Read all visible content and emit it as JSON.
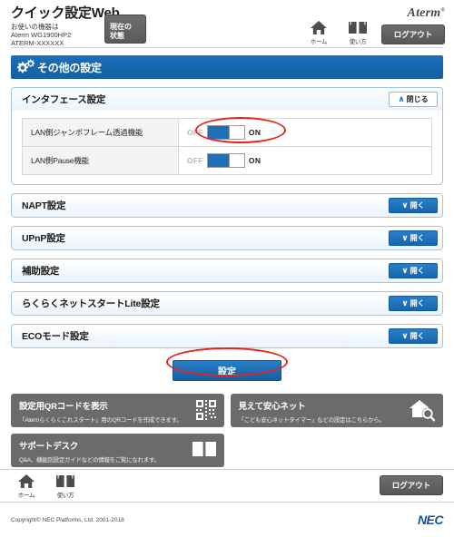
{
  "header": {
    "brand_title": "クイック設定Web",
    "device_lines": [
      "お使いの機器は",
      "Aterm WG1900HP2",
      "ATERM-XXXXXX"
    ],
    "status_button_label": "現在の\n状態",
    "status_button_line1": "現在の",
    "status_button_line2": "状態",
    "aterm_logo": "Aterm",
    "nav": [
      {
        "icon": "home-icon",
        "label": "ホーム"
      },
      {
        "icon": "book-icon",
        "label": "使い方"
      }
    ],
    "logout_label": "ログアウト"
  },
  "section": {
    "icon": "gears-icon",
    "title": "その他の設定"
  },
  "interface_panel": {
    "title": "インタフェース設定",
    "toggle_label": "閉じる",
    "toggle_chevron": "∧",
    "rows": [
      {
        "label": "LAN側ジャンボフレーム透過機能",
        "off_label": "OFF",
        "on_label": "ON",
        "state": "ON"
      },
      {
        "label": "LAN側Pause機能",
        "off_label": "OFF",
        "on_label": "ON",
        "state": "ON"
      }
    ]
  },
  "collapsed_panels": [
    {
      "title": "NAPT設定",
      "toggle_label": "開く",
      "toggle_chevron": "∨"
    },
    {
      "title": "UPnP設定",
      "toggle_label": "開く",
      "toggle_chevron": "∨"
    },
    {
      "title": "補助設定",
      "toggle_label": "開く",
      "toggle_chevron": "∨"
    },
    {
      "title": "らくらくネットスタートLite設定",
      "toggle_label": "開く",
      "toggle_chevron": "∨"
    },
    {
      "title": "ECOモード設定",
      "toggle_label": "開く",
      "toggle_chevron": "∨"
    }
  ],
  "submit": {
    "label": "設定"
  },
  "tiles": [
    {
      "title": "設定用QRコードを表示",
      "subtitle": "「Atermらくらくこれスタート」用のQRコードを作成できます。",
      "icon": "qr-code-icon"
    },
    {
      "title": "サポートデスク",
      "subtitle": "Q&A、機能別設定ガイドなどの情報をご覧になれます。",
      "icon": "book-icon"
    },
    {
      "title": "見えて安心ネット",
      "subtitle": "「こども安心ネットタイマー」などの設定はこちらから。",
      "icon": "house-search-icon"
    }
  ],
  "footer": {
    "nav": [
      {
        "icon": "home-icon",
        "label": "ホーム"
      },
      {
        "icon": "book-icon",
        "label": "使い方"
      }
    ],
    "logout_label": "ログアウト",
    "copyright": "Copyright© NEC Platforms, Ltd. 2001-2018",
    "nec_logo": "NEC"
  },
  "colors": {
    "accent_blue": "#1a6fc0",
    "panel_border": "#9cc6e8",
    "dark_gray": "#6b6b6b",
    "annotation_red": "#e8221c",
    "switch_on": "#1e6fb8"
  }
}
